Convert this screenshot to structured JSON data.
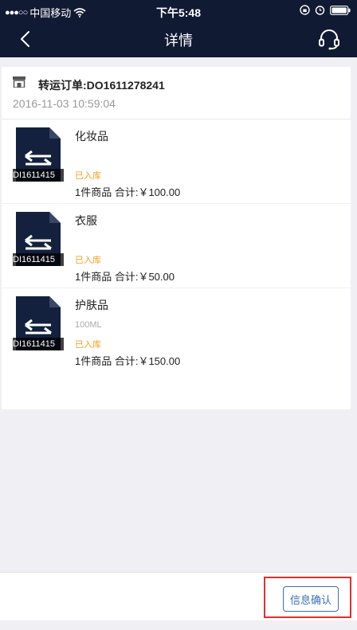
{
  "status_bar": {
    "signal": "●●●○○",
    "carrier": "中国移动",
    "time": "下午5:48"
  },
  "nav": {
    "title": "详情"
  },
  "order": {
    "label": "转运订单:DO1611278241",
    "time": "2016-11-03 10:59:04"
  },
  "items": [
    {
      "name": "化妆品",
      "spec": "",
      "status": "已入库",
      "summary": "1件商品  合计:￥100.00",
      "thumb_caption": "DI1611415"
    },
    {
      "name": "衣服",
      "spec": "",
      "status": "已入库",
      "summary": "1件商品  合计:￥50.00",
      "thumb_caption": "DI1611415"
    },
    {
      "name": "护肤品",
      "spec": "100ML",
      "status": "已入库",
      "summary": "1件商品  合计:￥150.00",
      "thumb_caption": "DI1611415"
    }
  ],
  "bottom": {
    "confirm_label": "信息确认"
  },
  "colors": {
    "header_bg": "#111a33",
    "status_orange": "#f0a020",
    "button_blue": "#3a6fb5",
    "highlight_red": "#e03030"
  },
  "icons": {
    "back": "chevron-left-icon",
    "service": "headset-icon",
    "store": "store-icon",
    "wifi": "wifi-icon",
    "alarm": "alarm-icon",
    "battery": "battery-icon"
  }
}
